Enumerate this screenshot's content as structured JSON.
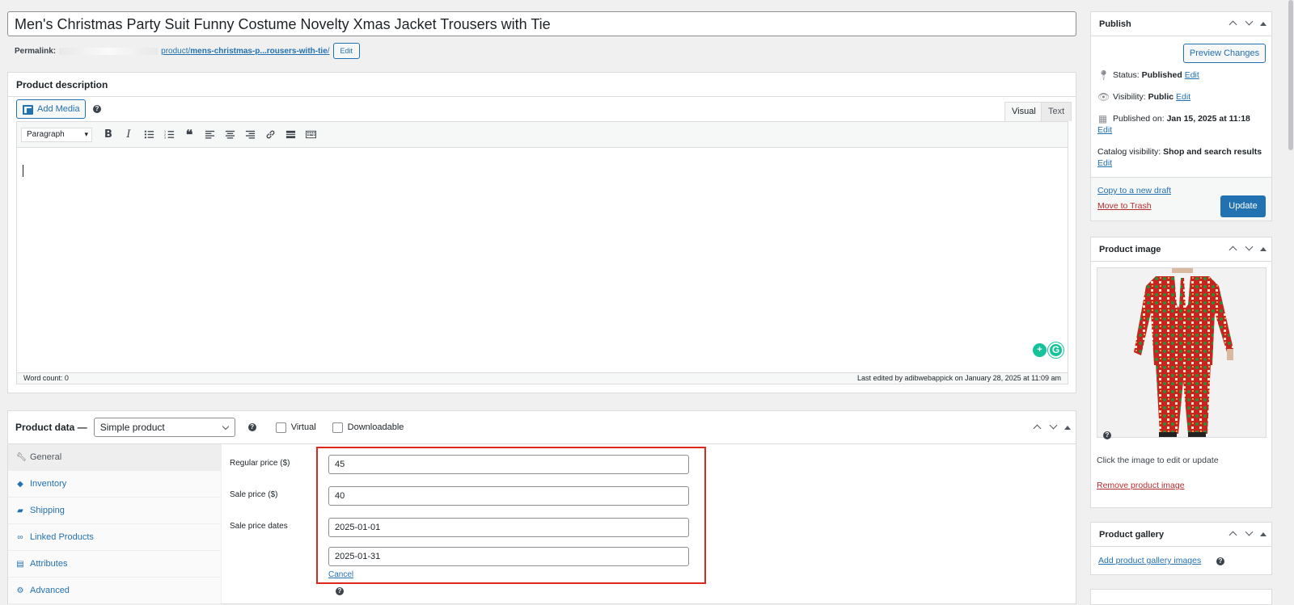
{
  "title": "Men's Christmas Party Suit Funny Costume Novelty Xmas Jacket Trousers with Tie",
  "permalink": {
    "label": "Permalink:",
    "link_prefix": "product/",
    "link_slug": "mens-christmas-p...rousers-with-tie",
    "link_suffix": "/",
    "edit": "Edit"
  },
  "description": {
    "heading": "Product description",
    "add_media": "Add Media",
    "help": "?",
    "tab_visual": "Visual",
    "tab_text": "Text",
    "format": "Paragraph",
    "word_count": "Word count: 0",
    "last_edited": "Last edited by adibwebappick on January 28, 2025 at 11:09 am"
  },
  "product_data": {
    "heading": "Product data —",
    "type": "Simple product",
    "help": "?",
    "virtual": "Virtual",
    "downloadable": "Downloadable",
    "tabs": [
      {
        "label": "General",
        "icon": "wrench-icon"
      },
      {
        "label": "Inventory",
        "icon": "tag-icon"
      },
      {
        "label": "Shipping",
        "icon": "truck-icon"
      },
      {
        "label": "Linked Products",
        "icon": "link-icon"
      },
      {
        "label": "Attributes",
        "icon": "list-icon"
      },
      {
        "label": "Advanced",
        "icon": "gear-icon"
      }
    ],
    "regular_price_label": "Regular price ($)",
    "regular_price": "45",
    "sale_price_label": "Sale price ($)",
    "sale_price": "40",
    "sale_dates_label": "Sale price dates",
    "sale_from": "2025-01-01",
    "sale_to": "2025-01-31",
    "cancel": "Cancel",
    "help2": "?"
  },
  "publish": {
    "heading": "Publish",
    "preview": "Preview Changes",
    "status_label": "Status:",
    "status_value": "Published",
    "visibility_label": "Visibility:",
    "visibility_value": "Public",
    "published_label": "Published on:",
    "published_value": "Jan 15, 2025 at 11:18",
    "catalog_label": "Catalog visibility:",
    "catalog_value": "Shop and search results",
    "edit": "Edit",
    "copy_draft": "Copy to a new draft",
    "trash": "Move to Trash",
    "update": "Update"
  },
  "product_image": {
    "heading": "Product image",
    "help": "?",
    "hint": "Click the image to edit or update",
    "remove": "Remove product image"
  },
  "product_gallery": {
    "heading": "Product gallery",
    "add": "Add product gallery images",
    "help": "?"
  },
  "colors": {
    "accent": "#2271b1",
    "highlight": "#e0261d",
    "trash": "#b32d2e"
  }
}
